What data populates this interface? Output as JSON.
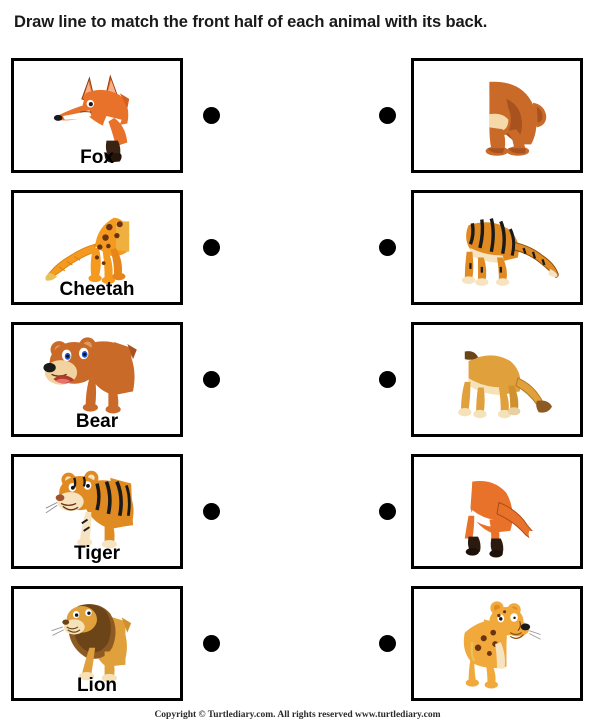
{
  "worksheet": {
    "title": "Draw line to match the front half of each animal with its back.",
    "footer": "Copyright © Turtlediary.com. All rights reserved  www.turtlediary.com",
    "dot_color": "#000000",
    "border_color": "#000000"
  },
  "rows": [
    {
      "left": {
        "label": "Fox",
        "art": "fox-front-half",
        "half": "front",
        "animal": "Fox",
        "colors": {
          "body": "#E8722A",
          "belly": "#FFFFFF",
          "leg": "#3B2314",
          "nose": "#1A1A1A"
        }
      },
      "right": {
        "label": "",
        "art": "bear-back-half",
        "half": "back",
        "animal": "Bear",
        "colors": {
          "body": "#C96A28",
          "shade": "#A85220",
          "belly": "#F5D9A8"
        }
      }
    },
    {
      "left": {
        "label": "Cheetah",
        "art": "cheetah-back-half",
        "half": "back",
        "animal": "Cheetah",
        "colors": {
          "body": "#F59A1E",
          "spots": "#6B3310",
          "tail": "#E8C257"
        }
      },
      "right": {
        "label": "",
        "art": "tiger-back-half",
        "half": "back",
        "animal": "Tiger",
        "colors": {
          "body": "#E08A22",
          "stripes": "#1A1A1A",
          "belly": "#F7E3C0"
        }
      }
    },
    {
      "left": {
        "label": "Bear",
        "art": "bear-front-half",
        "half": "front",
        "animal": "Bear",
        "colors": {
          "body": "#C96A28",
          "muzzle": "#F2D3A0",
          "eye": "#2255CC",
          "mouth": "#C0392B"
        }
      },
      "right": {
        "label": "",
        "art": "lion-back-half",
        "half": "back",
        "animal": "Lion",
        "colors": {
          "body": "#E0A03C",
          "tail_tuft": "#8C5A22",
          "paws": "#F5E2B8"
        }
      }
    },
    {
      "left": {
        "label": "Tiger",
        "art": "tiger-front-half",
        "half": "front",
        "animal": "Tiger",
        "colors": {
          "body": "#E08A22",
          "stripes": "#1A1A1A",
          "belly": "#F7E3C0"
        }
      },
      "right": {
        "label": "",
        "art": "fox-back-half",
        "half": "back",
        "animal": "Fox",
        "colors": {
          "body": "#E8722A",
          "tail_tip": "#FFFFFF",
          "legs": "#2B1A10"
        }
      }
    },
    {
      "left": {
        "label": "Lion",
        "art": "lion-front-half",
        "half": "front",
        "animal": "Lion",
        "colors": {
          "body": "#E0A03C",
          "mane": "#8C5A22",
          "muzzle": "#F5E2B8"
        }
      },
      "right": {
        "label": "",
        "art": "cheetah-front-half",
        "half": "front",
        "animal": "Cheetah",
        "colors": {
          "body": "#F0A93A",
          "spots": "#6B3310",
          "eye": "#2255CC",
          "nose": "#1A1A1A"
        }
      }
    }
  ]
}
